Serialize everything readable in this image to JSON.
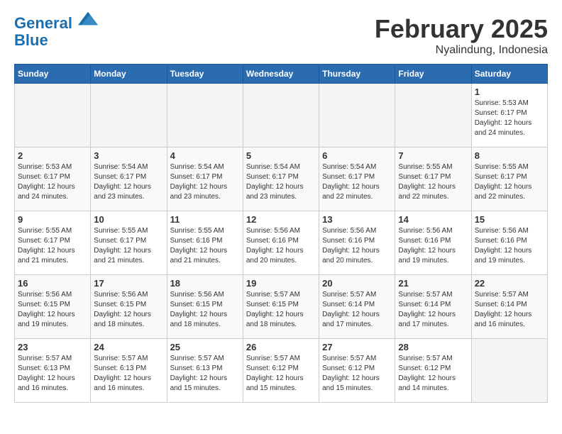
{
  "header": {
    "logo_line1": "General",
    "logo_line2": "Blue",
    "month_year": "February 2025",
    "location": "Nyalindung, Indonesia"
  },
  "weekdays": [
    "Sunday",
    "Monday",
    "Tuesday",
    "Wednesday",
    "Thursday",
    "Friday",
    "Saturday"
  ],
  "weeks": [
    [
      {
        "day": "",
        "info": ""
      },
      {
        "day": "",
        "info": ""
      },
      {
        "day": "",
        "info": ""
      },
      {
        "day": "",
        "info": ""
      },
      {
        "day": "",
        "info": ""
      },
      {
        "day": "",
        "info": ""
      },
      {
        "day": "1",
        "info": "Sunrise: 5:53 AM\nSunset: 6:17 PM\nDaylight: 12 hours\nand 24 minutes."
      }
    ],
    [
      {
        "day": "2",
        "info": "Sunrise: 5:53 AM\nSunset: 6:17 PM\nDaylight: 12 hours\nand 24 minutes."
      },
      {
        "day": "3",
        "info": "Sunrise: 5:54 AM\nSunset: 6:17 PM\nDaylight: 12 hours\nand 23 minutes."
      },
      {
        "day": "4",
        "info": "Sunrise: 5:54 AM\nSunset: 6:17 PM\nDaylight: 12 hours\nand 23 minutes."
      },
      {
        "day": "5",
        "info": "Sunrise: 5:54 AM\nSunset: 6:17 PM\nDaylight: 12 hours\nand 23 minutes."
      },
      {
        "day": "6",
        "info": "Sunrise: 5:54 AM\nSunset: 6:17 PM\nDaylight: 12 hours\nand 22 minutes."
      },
      {
        "day": "7",
        "info": "Sunrise: 5:55 AM\nSunset: 6:17 PM\nDaylight: 12 hours\nand 22 minutes."
      },
      {
        "day": "8",
        "info": "Sunrise: 5:55 AM\nSunset: 6:17 PM\nDaylight: 12 hours\nand 22 minutes."
      }
    ],
    [
      {
        "day": "9",
        "info": "Sunrise: 5:55 AM\nSunset: 6:17 PM\nDaylight: 12 hours\nand 21 minutes."
      },
      {
        "day": "10",
        "info": "Sunrise: 5:55 AM\nSunset: 6:17 PM\nDaylight: 12 hours\nand 21 minutes."
      },
      {
        "day": "11",
        "info": "Sunrise: 5:55 AM\nSunset: 6:16 PM\nDaylight: 12 hours\nand 21 minutes."
      },
      {
        "day": "12",
        "info": "Sunrise: 5:56 AM\nSunset: 6:16 PM\nDaylight: 12 hours\nand 20 minutes."
      },
      {
        "day": "13",
        "info": "Sunrise: 5:56 AM\nSunset: 6:16 PM\nDaylight: 12 hours\nand 20 minutes."
      },
      {
        "day": "14",
        "info": "Sunrise: 5:56 AM\nSunset: 6:16 PM\nDaylight: 12 hours\nand 19 minutes."
      },
      {
        "day": "15",
        "info": "Sunrise: 5:56 AM\nSunset: 6:16 PM\nDaylight: 12 hours\nand 19 minutes."
      }
    ],
    [
      {
        "day": "16",
        "info": "Sunrise: 5:56 AM\nSunset: 6:15 PM\nDaylight: 12 hours\nand 19 minutes."
      },
      {
        "day": "17",
        "info": "Sunrise: 5:56 AM\nSunset: 6:15 PM\nDaylight: 12 hours\nand 18 minutes."
      },
      {
        "day": "18",
        "info": "Sunrise: 5:56 AM\nSunset: 6:15 PM\nDaylight: 12 hours\nand 18 minutes."
      },
      {
        "day": "19",
        "info": "Sunrise: 5:57 AM\nSunset: 6:15 PM\nDaylight: 12 hours\nand 18 minutes."
      },
      {
        "day": "20",
        "info": "Sunrise: 5:57 AM\nSunset: 6:14 PM\nDaylight: 12 hours\nand 17 minutes."
      },
      {
        "day": "21",
        "info": "Sunrise: 5:57 AM\nSunset: 6:14 PM\nDaylight: 12 hours\nand 17 minutes."
      },
      {
        "day": "22",
        "info": "Sunrise: 5:57 AM\nSunset: 6:14 PM\nDaylight: 12 hours\nand 16 minutes."
      }
    ],
    [
      {
        "day": "23",
        "info": "Sunrise: 5:57 AM\nSunset: 6:13 PM\nDaylight: 12 hours\nand 16 minutes."
      },
      {
        "day": "24",
        "info": "Sunrise: 5:57 AM\nSunset: 6:13 PM\nDaylight: 12 hours\nand 16 minutes."
      },
      {
        "day": "25",
        "info": "Sunrise: 5:57 AM\nSunset: 6:13 PM\nDaylight: 12 hours\nand 15 minutes."
      },
      {
        "day": "26",
        "info": "Sunrise: 5:57 AM\nSunset: 6:12 PM\nDaylight: 12 hours\nand 15 minutes."
      },
      {
        "day": "27",
        "info": "Sunrise: 5:57 AM\nSunset: 6:12 PM\nDaylight: 12 hours\nand 15 minutes."
      },
      {
        "day": "28",
        "info": "Sunrise: 5:57 AM\nSunset: 6:12 PM\nDaylight: 12 hours\nand 14 minutes."
      },
      {
        "day": "",
        "info": ""
      }
    ]
  ]
}
